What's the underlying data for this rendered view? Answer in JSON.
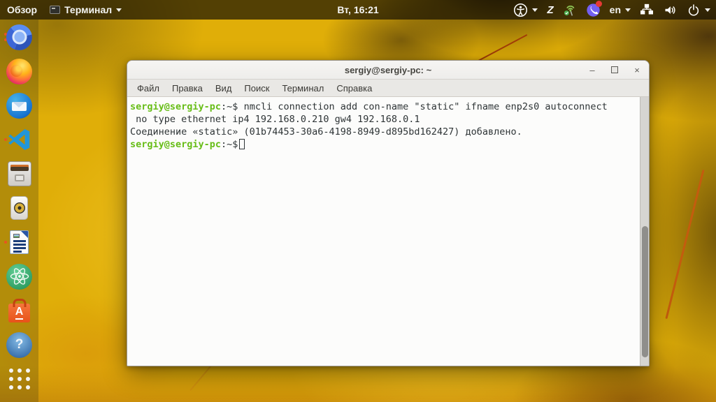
{
  "top_bar": {
    "activities_label": "Обзор",
    "app_menu": {
      "icon": "terminal-icon",
      "label": "Терминал"
    },
    "clock": "Вт, 16:21",
    "right": {
      "accessibility": "accessibility-icon",
      "zoom_glyph": "Z",
      "network_signal": "network-signal-icon",
      "viber": "viber-icon",
      "language": "en",
      "wired_network": "wired-network-icon",
      "volume": "volume-icon",
      "power": "power-icon"
    }
  },
  "dock": {
    "items": [
      {
        "icon": "chromium-icon",
        "running_indicator_dots": 2
      },
      {
        "icon": "firefox-icon",
        "running_indicator_dots": 0
      },
      {
        "icon": "thunderbird-icon",
        "running_indicator_dots": 0
      },
      {
        "icon": "vscode-icon",
        "running_indicator_dots": 1
      },
      {
        "icon": "file-cabinet-icon",
        "running_indicator_dots": 0
      },
      {
        "icon": "speaker-app-icon",
        "running_indicator_dots": 0
      },
      {
        "icon": "libreoffice-writer-icon",
        "running_indicator_dots": 1
      },
      {
        "icon": "atom-icon",
        "running_indicator_dots": 0
      },
      {
        "icon": "software-store-icon",
        "running_indicator_dots": 0,
        "glyph": "A"
      },
      {
        "icon": "help-icon",
        "running_indicator_dots": 0,
        "glyph": "?"
      },
      {
        "icon": "show-applications-icon",
        "running_indicator_dots": 0
      }
    ]
  },
  "window": {
    "title": "sergiy@sergiy-pc: ~",
    "controls": {
      "minimize": "–",
      "maximize_icon": "square-outline-icon",
      "close": "×"
    },
    "menu_items": [
      "Файл",
      "Правка",
      "Вид",
      "Поиск",
      "Терминал",
      "Справка"
    ],
    "terminal": {
      "prompt_user_host": "sergiy@sergiy-pc",
      "prompt_tail": ":~$",
      "command_line1": " nmcli connection add con-name \"static\" ifname enp2s0 autoconnect",
      "command_line2": " no type ethernet ip4 192.168.0.210 gw4 192.168.0.1",
      "output_line": "Соединение «static» (01b74453-30a6-4198-8949-d895bd162427) добавлено.",
      "prompt2_user_host": "sergiy@sergiy-pc",
      "prompt2_tail": ":~$"
    }
  },
  "colors": {
    "accent_orange": "#e95420",
    "prompt_green": "#67bd17",
    "terminal_text": "#2e3436",
    "terminal_background": "#fcfcfb",
    "topbar_background": "rgba(16,12,3,0.68)",
    "viber_purple": "#7360f2",
    "wallpaper_yellow": "#e0ae08"
  }
}
